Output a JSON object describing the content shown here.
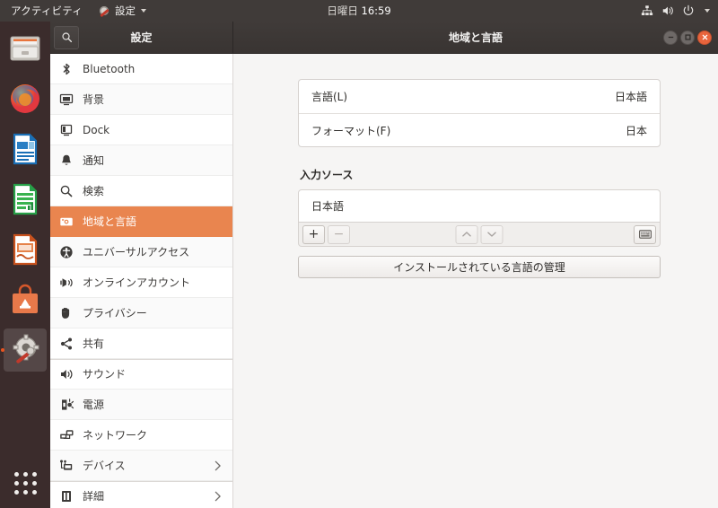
{
  "topbar": {
    "activities": "アクティビティ",
    "app_menu_label": "設定",
    "app_icon": "settings-gear-wrench-icon",
    "clock_day": "日曜日",
    "clock_time": "16:59",
    "indicators": [
      "network-icon",
      "volume-icon",
      "power-icon",
      "chevron-down-icon"
    ]
  },
  "dock": {
    "items": [
      {
        "name": "files",
        "icon": "file-manager-icon"
      },
      {
        "name": "firefox",
        "icon": "firefox-icon"
      },
      {
        "name": "libreoffice-writer",
        "icon": "writer-document-icon"
      },
      {
        "name": "libreoffice-calc",
        "icon": "calc-spreadsheet-icon"
      },
      {
        "name": "libreoffice-impress",
        "icon": "impress-presentation-icon"
      },
      {
        "name": "ubuntu-software",
        "icon": "software-store-icon"
      },
      {
        "name": "settings",
        "icon": "settings-gear-wrench-icon",
        "active": true
      }
    ],
    "show_apps": "show-applications-grid-icon"
  },
  "window": {
    "sidebar_title": "設定",
    "panel_title": "地域と言語",
    "search_icon": "search-icon",
    "controls": {
      "minimize": "minimize-icon",
      "maximize": "maximize-icon",
      "close": "close-icon"
    }
  },
  "sidebar": {
    "items": [
      {
        "label": "Bluetooth",
        "icon": "bluetooth-icon",
        "selected": false,
        "group_start": false,
        "chevron": false
      },
      {
        "label": "背景",
        "icon": "wallpaper-icon",
        "selected": false,
        "group_start": false,
        "chevron": false
      },
      {
        "label": "Dock",
        "icon": "dock-icon",
        "selected": false,
        "group_start": false,
        "chevron": false
      },
      {
        "label": "通知",
        "icon": "bell-icon",
        "selected": false,
        "group_start": false,
        "chevron": false
      },
      {
        "label": "検索",
        "icon": "search-icon",
        "selected": false,
        "group_start": false,
        "chevron": false
      },
      {
        "label": "地域と言語",
        "icon": "region-language-icon",
        "selected": true,
        "group_start": false,
        "chevron": false
      },
      {
        "label": "ユニバーサルアクセス",
        "icon": "accessibility-icon",
        "selected": false,
        "group_start": false,
        "chevron": false
      },
      {
        "label": "オンラインアカウント",
        "icon": "online-accounts-icon",
        "selected": false,
        "group_start": false,
        "chevron": false
      },
      {
        "label": "プライバシー",
        "icon": "privacy-hand-icon",
        "selected": false,
        "group_start": false,
        "chevron": false
      },
      {
        "label": "共有",
        "icon": "sharing-icon",
        "selected": false,
        "group_start": false,
        "chevron": false
      },
      {
        "label": "サウンド",
        "icon": "sound-speaker-icon",
        "selected": false,
        "group_start": true,
        "chevron": false
      },
      {
        "label": "電源",
        "icon": "power-plug-icon",
        "selected": false,
        "group_start": false,
        "chevron": false
      },
      {
        "label": "ネットワーク",
        "icon": "network-icon",
        "selected": false,
        "group_start": false,
        "chevron": false
      },
      {
        "label": "デバイス",
        "icon": "devices-icon",
        "selected": false,
        "group_start": false,
        "chevron": true
      },
      {
        "label": "詳細",
        "icon": "details-info-icon",
        "selected": false,
        "group_start": true,
        "chevron": true
      }
    ]
  },
  "content": {
    "rows": [
      {
        "label": "言語(L)",
        "value": "日本語"
      },
      {
        "label": "フォーマット(F)",
        "value": "日本"
      }
    ],
    "input_sources": {
      "title": "入力ソース",
      "items": [
        "日本語"
      ],
      "toolbar": {
        "add": "+",
        "remove": "−",
        "move_up": "up-chevron-icon",
        "move_down": "down-chevron-icon",
        "preview": "keyboard-icon"
      }
    },
    "manage_button": "インストールされている言語の管理"
  },
  "colors": {
    "accent_orange": "#e9854f",
    "close_button": "#e8643c",
    "topbar_bg": "#403b39",
    "dock_bg": "#3b2c2c",
    "content_bg": "#f6f5f4"
  }
}
